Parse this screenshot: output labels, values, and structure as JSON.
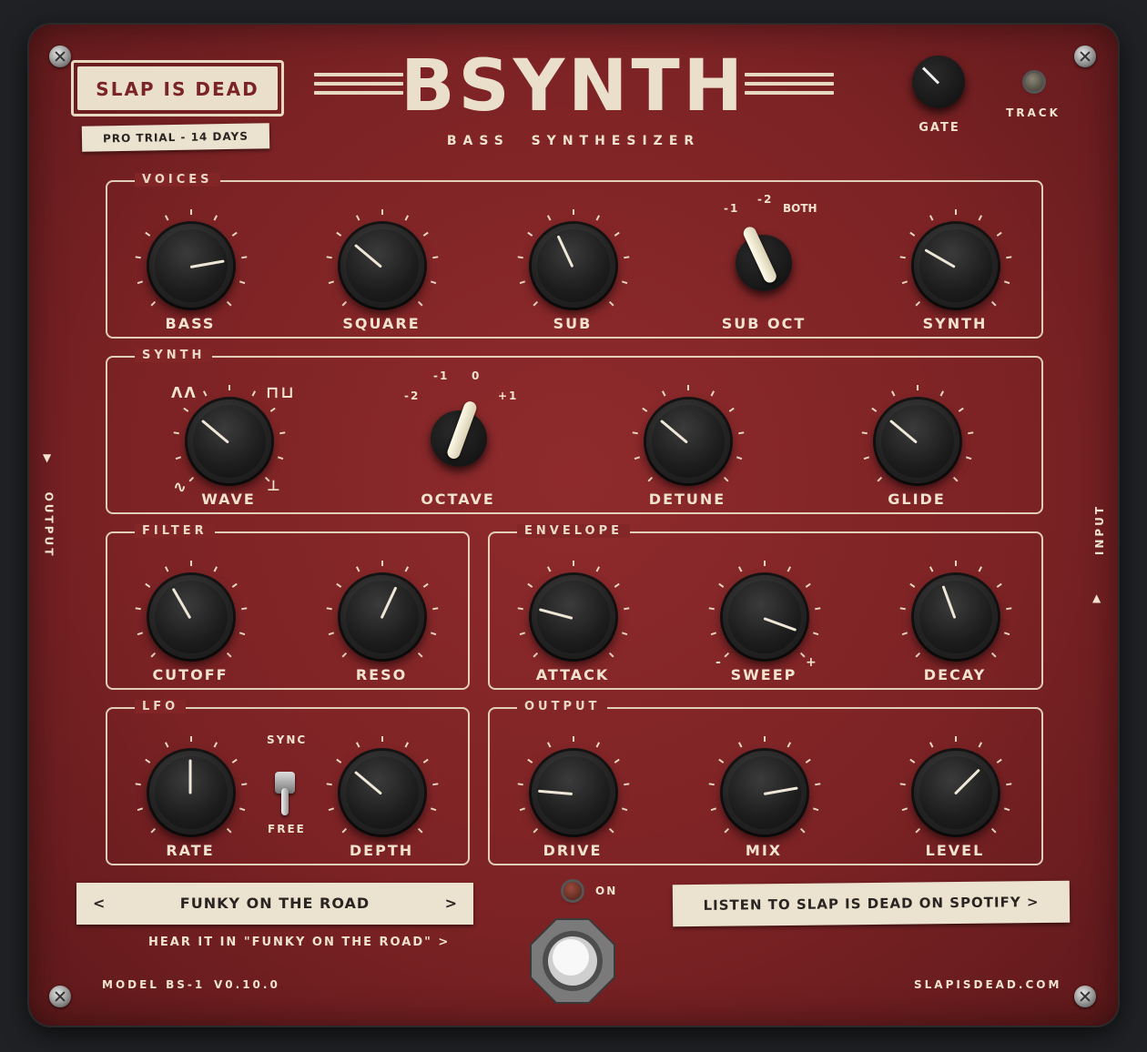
{
  "brand": {
    "badge": "SLAP IS DEAD",
    "trial": "PRO TRIAL - 14 DAYS",
    "title": "BSYNTH",
    "subtitle": "BASS  SYNTHESIZER"
  },
  "header": {
    "gate_label": "GATE",
    "track_label": "TRACK"
  },
  "side": {
    "output": "OUTPUT",
    "input": "INPUT"
  },
  "voices": {
    "title": "VOICES",
    "knobs": [
      {
        "label": "BASS"
      },
      {
        "label": "SQUARE"
      },
      {
        "label": "SUB"
      },
      {
        "label": "SUB OCT"
      },
      {
        "label": "SYNTH"
      }
    ],
    "sub_oct_options": [
      "-1",
      "-2",
      "BOTH"
    ]
  },
  "synth": {
    "title": "SYNTH",
    "knobs": [
      {
        "label": "WAVE"
      },
      {
        "label": "OCTAVE"
      },
      {
        "label": "DETUNE"
      },
      {
        "label": "GLIDE"
      }
    ],
    "octave_options": [
      "-2",
      "-1",
      "0",
      "+1"
    ]
  },
  "filter": {
    "title": "FILTER",
    "knobs": [
      {
        "label": "CUTOFF"
      },
      {
        "label": "RESO"
      }
    ]
  },
  "envelope": {
    "title": "ENVELOPE",
    "knobs": [
      {
        "label": "ATTACK"
      },
      {
        "label": "SWEEP"
      },
      {
        "label": "DECAY"
      }
    ],
    "sweep_minus": "-",
    "sweep_plus": "+"
  },
  "lfo": {
    "title": "LFO",
    "knobs": [
      {
        "label": "RATE"
      },
      {
        "label": "DEPTH"
      }
    ],
    "sync_label": "SYNC",
    "free_label": "FREE"
  },
  "output": {
    "title": "OUTPUT",
    "knobs": [
      {
        "label": "DRIVE"
      },
      {
        "label": "MIX"
      },
      {
        "label": "LEVEL"
      }
    ]
  },
  "preset": {
    "prev": "<",
    "name": "FUNKY ON THE ROAD",
    "next": ">",
    "hear_link": "HEAR IT IN \"FUNKY ON THE ROAD\"  >"
  },
  "power": {
    "on_label": "ON"
  },
  "spotify": {
    "label": "LISTEN TO SLAP IS DEAD ON SPOTIFY >"
  },
  "footer": {
    "model": "MODEL BS-1",
    "version": "V0.10.0",
    "site": "SLAPISDEAD.COM"
  }
}
